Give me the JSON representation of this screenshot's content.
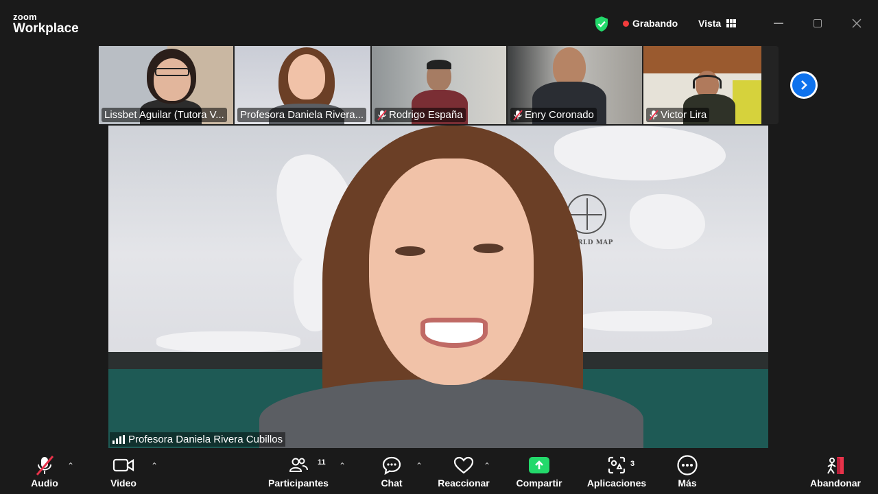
{
  "titlebar": {
    "logo_top": "zoom",
    "logo_bottom": "Workplace",
    "recording_label": "Grabando",
    "view_label": "Vista"
  },
  "strip": {
    "tiles": [
      {
        "name": "Lissbet Aguilar (Tutora V...",
        "muted": false,
        "active": false
      },
      {
        "name": "Profesora Daniela Rivera...",
        "muted": false,
        "active": true
      },
      {
        "name": "Rodrigo España",
        "muted": true,
        "active": false
      },
      {
        "name": "Enry Coronado",
        "muted": true,
        "active": false
      },
      {
        "name": "Victor Lira",
        "muted": true,
        "active": false
      }
    ]
  },
  "main_video": {
    "speaker_name": "Profesora Daniela Rivera Cubillos",
    "map_title": "WORLD MAP"
  },
  "toolbar": {
    "audio": "Audio",
    "video": "Video",
    "participants": "Participantes",
    "participants_count": "11",
    "chat": "Chat",
    "react": "Reaccionar",
    "share": "Compartir",
    "apps": "Aplicaciones",
    "apps_count": "3",
    "more": "Más",
    "leave": "Abandonar"
  },
  "colors": {
    "accent_green": "#23d96b",
    "record_red": "#f23c3c",
    "nav_blue": "#0e72ed",
    "mute_red": "#e8334a"
  }
}
